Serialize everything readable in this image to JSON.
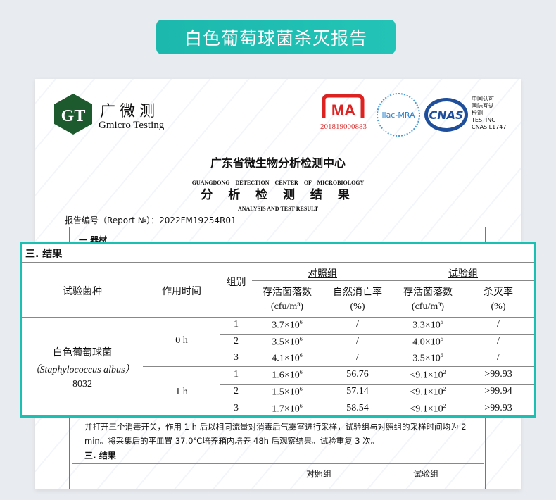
{
  "banner": {
    "title": "白色葡萄球菌杀灭报告"
  },
  "header": {
    "brand_cn": "广微测",
    "brand_en": "Gmicro Testing",
    "logo_text": "GT",
    "cma_text": "MA",
    "cma_number": "201819000883",
    "ilac_text": "ilac-MRA",
    "cnas_text": "CNAS",
    "cnas_side": [
      "中国认可",
      "国际互认",
      "检测",
      "TESTING",
      "CNAS L1747"
    ]
  },
  "document": {
    "org_cn": "广东省微生物分析检测中心",
    "org_en": "GUANGDONG DETECTION CENTER OF MICROBIOLOGY",
    "title_cn": "分 析 检 测 结 果",
    "title_en": "ANALYSIS AND TEST RESULT",
    "report_no": "报告编号（Report №）：2022FM19254R01",
    "section1": "一  器材",
    "paragraph": "并打开三个消毒开关，作用 1 h 后以相同流量对消毒后气雾室进行采样，试验组与对照组的采样时间均为 2 min。将采集后的平皿置 37.0℃培养箱内培养 48h 后观察结果。试验重复 3 次。",
    "section3": "三. 结果",
    "partial_headers": [
      "对照组",
      "试验组"
    ]
  },
  "table": {
    "section": "三.  结果",
    "headers": {
      "species": "试验菌种",
      "time": "作用时间",
      "group": "组别",
      "control": "对照组",
      "test": "试验组",
      "cfu": "存活菌落数",
      "cfu_unit": "(cfu/m³)",
      "natural": "自然消亡率",
      "pct": "(%)",
      "kill": "杀灭率"
    },
    "species": {
      "cn": "白色葡萄球菌",
      "latin": "（Staphylococcus albus）",
      "code": "8032"
    },
    "times": [
      "0 h",
      "1 h"
    ],
    "rows": [
      {
        "g": "1",
        "c_base": "3.7×10",
        "c_exp": "6",
        "nat": "/",
        "t_base": "3.3×10",
        "t_exp": "6",
        "kill": "/"
      },
      {
        "g": "2",
        "c_base": "3.5×10",
        "c_exp": "6",
        "nat": "/",
        "t_base": "4.0×10",
        "t_exp": "6",
        "kill": "/"
      },
      {
        "g": "3",
        "c_base": "4.1×10",
        "c_exp": "6",
        "nat": "/",
        "t_base": "3.5×10",
        "t_exp": "6",
        "kill": "/"
      },
      {
        "g": "1",
        "c_base": "1.6×10",
        "c_exp": "6",
        "nat": "56.76",
        "t_base": "<9.1×10",
        "t_exp": "2",
        "kill": ">99.93"
      },
      {
        "g": "2",
        "c_base": "1.5×10",
        "c_exp": "6",
        "nat": "57.14",
        "t_base": "<9.1×10",
        "t_exp": "2",
        "kill": ">99.94"
      },
      {
        "g": "3",
        "c_base": "1.7×10",
        "c_exp": "6",
        "nat": "58.54",
        "t_base": "<9.1×10",
        "t_exp": "2",
        "kill": ">99.93"
      }
    ]
  }
}
